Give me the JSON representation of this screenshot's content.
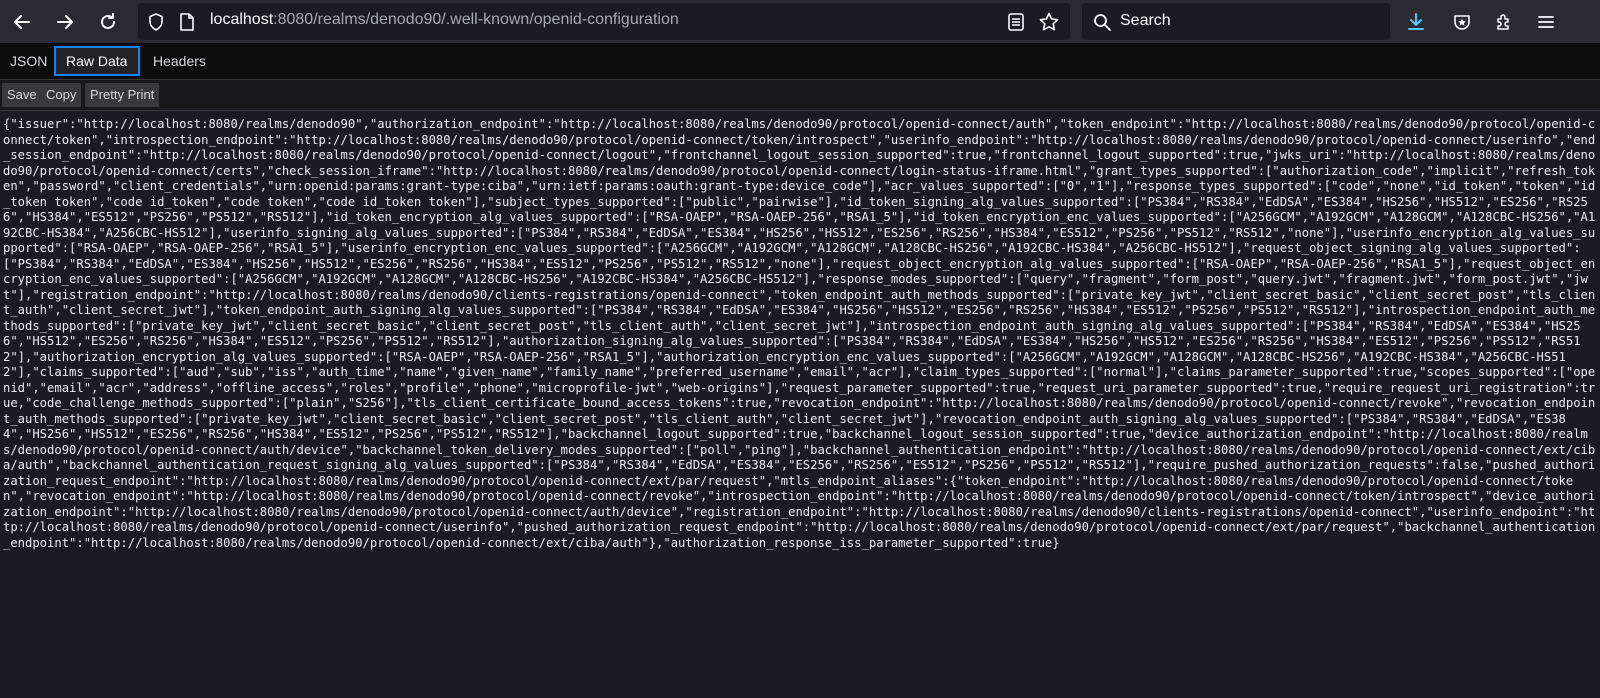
{
  "browser": {
    "url_host": "localhost",
    "url_rest": ":8080/realms/denodo90/.well-known/openid-configuration",
    "search_placeholder": "Search"
  },
  "viewer": {
    "tabs": [
      "JSON",
      "Raw Data",
      "Headers"
    ],
    "selected_tab": "Raw Data",
    "buttons": {
      "save": "Save",
      "copy": "Copy",
      "pretty": "Pretty Print"
    }
  },
  "raw_text": "{\"issuer\":\"http://localhost:8080/realms/denodo90\",\"authorization_endpoint\":\"http://localhost:8080/realms/denodo90/protocol/openid-connect/auth\",\"token_endpoint\":\"http://localhost:8080/realms/denodo90/protocol/openid-connect/token\",\"introspection_endpoint\":\"http://localhost:8080/realms/denodo90/protocol/openid-connect/token/introspect\",\"userinfo_endpoint\":\"http://localhost:8080/realms/denodo90/protocol/openid-connect/userinfo\",\"end_session_endpoint\":\"http://localhost:8080/realms/denodo90/protocol/openid-connect/logout\",\"frontchannel_logout_session_supported\":true,\"frontchannel_logout_supported\":true,\"jwks_uri\":\"http://localhost:8080/realms/denodo90/protocol/openid-connect/certs\",\"check_session_iframe\":\"http://localhost:8080/realms/denodo90/protocol/openid-connect/login-status-iframe.html\",\"grant_types_supported\":[\"authorization_code\",\"implicit\",\"refresh_token\",\"password\",\"client_credentials\",\"urn:openid:params:grant-type:ciba\",\"urn:ietf:params:oauth:grant-type:device_code\"],\"acr_values_supported\":[\"0\",\"1\"],\"response_types_supported\":[\"code\",\"none\",\"id_token\",\"token\",\"id_token token\",\"code id_token\",\"code token\",\"code id_token token\"],\"subject_types_supported\":[\"public\",\"pairwise\"],\"id_token_signing_alg_values_supported\":[\"PS384\",\"RS384\",\"EdDSA\",\"ES384\",\"HS256\",\"HS512\",\"ES256\",\"RS256\",\"HS384\",\"ES512\",\"PS256\",\"PS512\",\"RS512\"],\"id_token_encryption_alg_values_supported\":[\"RSA-OAEP\",\"RSA-OAEP-256\",\"RSA1_5\"],\"id_token_encryption_enc_values_supported\":[\"A256GCM\",\"A192GCM\",\"A128GCM\",\"A128CBC-HS256\",\"A192CBC-HS384\",\"A256CBC-HS512\"],\"userinfo_signing_alg_values_supported\":[\"PS384\",\"RS384\",\"EdDSA\",\"ES384\",\"HS256\",\"HS512\",\"ES256\",\"RS256\",\"HS384\",\"ES512\",\"PS256\",\"PS512\",\"RS512\",\"none\"],\"userinfo_encryption_alg_values_supported\":[\"RSA-OAEP\",\"RSA-OAEP-256\",\"RSA1_5\"],\"userinfo_encryption_enc_values_supported\":[\"A256GCM\",\"A192GCM\",\"A128GCM\",\"A128CBC-HS256\",\"A192CBC-HS384\",\"A256CBC-HS512\"],\"request_object_signing_alg_values_supported\":[\"PS384\",\"RS384\",\"EdDSA\",\"ES384\",\"HS256\",\"HS512\",\"ES256\",\"RS256\",\"HS384\",\"ES512\",\"PS256\",\"PS512\",\"RS512\",\"none\"],\"request_object_encryption_alg_values_supported\":[\"RSA-OAEP\",\"RSA-OAEP-256\",\"RSA1_5\"],\"request_object_encryption_enc_values_supported\":[\"A256GCM\",\"A192GCM\",\"A128GCM\",\"A128CBC-HS256\",\"A192CBC-HS384\",\"A256CBC-HS512\"],\"response_modes_supported\":[\"query\",\"fragment\",\"form_post\",\"query.jwt\",\"fragment.jwt\",\"form_post.jwt\",\"jwt\"],\"registration_endpoint\":\"http://localhost:8080/realms/denodo90/clients-registrations/openid-connect\",\"token_endpoint_auth_methods_supported\":[\"private_key_jwt\",\"client_secret_basic\",\"client_secret_post\",\"tls_client_auth\",\"client_secret_jwt\"],\"token_endpoint_auth_signing_alg_values_supported\":[\"PS384\",\"RS384\",\"EdDSA\",\"ES384\",\"HS256\",\"HS512\",\"ES256\",\"RS256\",\"HS384\",\"ES512\",\"PS256\",\"PS512\",\"RS512\"],\"introspection_endpoint_auth_methods_supported\":[\"private_key_jwt\",\"client_secret_basic\",\"client_secret_post\",\"tls_client_auth\",\"client_secret_jwt\"],\"introspection_endpoint_auth_signing_alg_values_supported\":[\"PS384\",\"RS384\",\"EdDSA\",\"ES384\",\"HS256\",\"HS512\",\"ES256\",\"RS256\",\"HS384\",\"ES512\",\"PS256\",\"PS512\",\"RS512\"],\"authorization_signing_alg_values_supported\":[\"PS384\",\"RS384\",\"EdDSA\",\"ES384\",\"HS256\",\"HS512\",\"ES256\",\"RS256\",\"HS384\",\"ES512\",\"PS256\",\"PS512\",\"RS512\"],\"authorization_encryption_alg_values_supported\":[\"RSA-OAEP\",\"RSA-OAEP-256\",\"RSA1_5\"],\"authorization_encryption_enc_values_supported\":[\"A256GCM\",\"A192GCM\",\"A128GCM\",\"A128CBC-HS256\",\"A192CBC-HS384\",\"A256CBC-HS512\"],\"claims_supported\":[\"aud\",\"sub\",\"iss\",\"auth_time\",\"name\",\"given_name\",\"family_name\",\"preferred_username\",\"email\",\"acr\"],\"claim_types_supported\":[\"normal\"],\"claims_parameter_supported\":true,\"scopes_supported\":[\"openid\",\"email\",\"acr\",\"address\",\"offline_access\",\"roles\",\"profile\",\"phone\",\"microprofile-jwt\",\"web-origins\"],\"request_parameter_supported\":true,\"request_uri_parameter_supported\":true,\"require_request_uri_registration\":true,\"code_challenge_methods_supported\":[\"plain\",\"S256\"],\"tls_client_certificate_bound_access_tokens\":true,\"revocation_endpoint\":\"http://localhost:8080/realms/denodo90/protocol/openid-connect/revoke\",\"revocation_endpoint_auth_methods_supported\":[\"private_key_jwt\",\"client_secret_basic\",\"client_secret_post\",\"tls_client_auth\",\"client_secret_jwt\"],\"revocation_endpoint_auth_signing_alg_values_supported\":[\"PS384\",\"RS384\",\"EdDSA\",\"ES384\",\"HS256\",\"HS512\",\"ES256\",\"RS256\",\"HS384\",\"ES512\",\"PS256\",\"PS512\",\"RS512\"],\"backchannel_logout_supported\":true,\"backchannel_logout_session_supported\":true,\"device_authorization_endpoint\":\"http://localhost:8080/realms/denodo90/protocol/openid-connect/auth/device\",\"backchannel_token_delivery_modes_supported\":[\"poll\",\"ping\"],\"backchannel_authentication_endpoint\":\"http://localhost:8080/realms/denodo90/protocol/openid-connect/ext/ciba/auth\",\"backchannel_authentication_request_signing_alg_values_supported\":[\"PS384\",\"RS384\",\"EdDSA\",\"ES384\",\"ES256\",\"RS256\",\"ES512\",\"PS256\",\"PS512\",\"RS512\"],\"require_pushed_authorization_requests\":false,\"pushed_authorization_request_endpoint\":\"http://localhost:8080/realms/denodo90/protocol/openid-connect/ext/par/request\",\"mtls_endpoint_aliases\":{\"token_endpoint\":\"http://localhost:8080/realms/denodo90/protocol/openid-connect/token\",\"revocation_endpoint\":\"http://localhost:8080/realms/denodo90/protocol/openid-connect/revoke\",\"introspection_endpoint\":\"http://localhost:8080/realms/denodo90/protocol/openid-connect/token/introspect\",\"device_authorization_endpoint\":\"http://localhost:8080/realms/denodo90/protocol/openid-connect/auth/device\",\"registration_endpoint\":\"http://localhost:8080/realms/denodo90/clients-registrations/openid-connect\",\"userinfo_endpoint\":\"http://localhost:8080/realms/denodo90/protocol/openid-connect/userinfo\",\"pushed_authorization_request_endpoint\":\"http://localhost:8080/realms/denodo90/protocol/openid-connect/ext/par/request\",\"backchannel_authentication_endpoint\":\"http://localhost:8080/realms/denodo90/protocol/openid-connect/ext/ciba/auth\"},\"authorization_response_iss_parameter_supported\":true}"
}
